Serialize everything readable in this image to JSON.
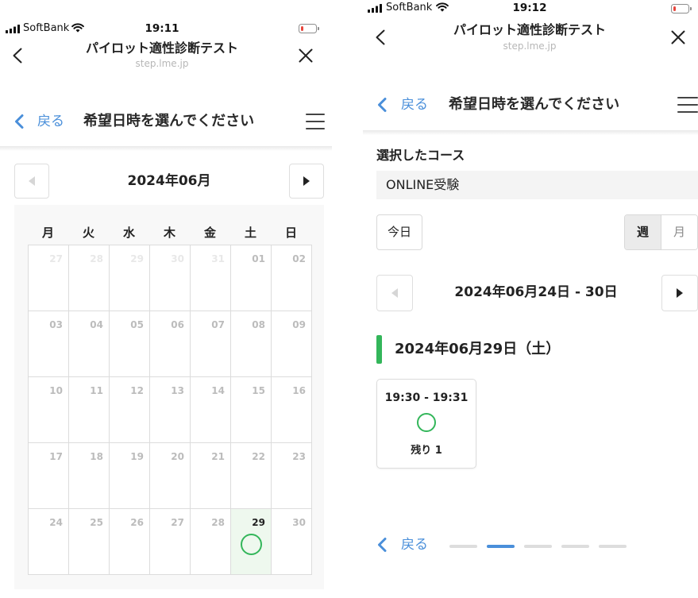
{
  "colors": {
    "accent": "#4a8fda",
    "green": "#33b65a",
    "available_bg": "#eef8ee",
    "battery_low": "#e8453c"
  },
  "left": {
    "status": {
      "carrier": "SoftBank",
      "time": "19:11",
      "battery_level": 0.15,
      "icons": [
        "signal-icon",
        "wifi-icon",
        "battery-icon"
      ]
    },
    "header": {
      "title": "パイロット適性診断テスト",
      "subtitle": "step.lme.jp",
      "back_icon": "chevron-left-icon",
      "close_icon": "close-icon"
    },
    "nav": {
      "back_label": "戻る",
      "title": "希望日時を選んでください",
      "menu_icon": "hamburger-menu-icon"
    },
    "calendar": {
      "month_label": "2024年06月",
      "prev_enabled": false,
      "next_enabled": true,
      "weekdays": [
        "月",
        "火",
        "水",
        "木",
        "金",
        "土",
        "日"
      ],
      "days": [
        {
          "label": "27",
          "muted": true
        },
        {
          "label": "28",
          "muted": true
        },
        {
          "label": "29",
          "muted": true
        },
        {
          "label": "30",
          "muted": true
        },
        {
          "label": "31",
          "muted": true
        },
        {
          "label": "01"
        },
        {
          "label": "02"
        },
        {
          "label": "03"
        },
        {
          "label": "04"
        },
        {
          "label": "05"
        },
        {
          "label": "06"
        },
        {
          "label": "07"
        },
        {
          "label": "08"
        },
        {
          "label": "09"
        },
        {
          "label": "10"
        },
        {
          "label": "11"
        },
        {
          "label": "12"
        },
        {
          "label": "13"
        },
        {
          "label": "14"
        },
        {
          "label": "15"
        },
        {
          "label": "16"
        },
        {
          "label": "17"
        },
        {
          "label": "18"
        },
        {
          "label": "19"
        },
        {
          "label": "20"
        },
        {
          "label": "21"
        },
        {
          "label": "22"
        },
        {
          "label": "23"
        },
        {
          "label": "24"
        },
        {
          "label": "25"
        },
        {
          "label": "26"
        },
        {
          "label": "27"
        },
        {
          "label": "28"
        },
        {
          "label": "29",
          "available": true
        },
        {
          "label": "30"
        }
      ]
    }
  },
  "right": {
    "status": {
      "carrier": "SoftBank",
      "time": "19:12",
      "battery_level": 0.15,
      "icons": [
        "signal-icon",
        "wifi-icon",
        "battery-icon"
      ]
    },
    "header": {
      "title": "パイロット適性診断テスト",
      "subtitle": "step.lme.jp",
      "back_icon": "chevron-left-icon",
      "close_icon": "close-icon"
    },
    "nav": {
      "back_label": "戻る",
      "title": "希望日時を選んでください",
      "menu_icon": "hamburger-menu-icon"
    },
    "course": {
      "label": "選択したコース",
      "value": "ONLINE受験"
    },
    "view_controls": {
      "today_label": "今日",
      "views": [
        {
          "label": "週",
          "active": true
        },
        {
          "label": "月",
          "active": false
        }
      ]
    },
    "week_nav": {
      "range_label": "2024年06月24日 - 30日",
      "prev_enabled": false,
      "next_enabled": true
    },
    "day": {
      "heading": "2024年06月29日（土）",
      "slots": [
        {
          "time": "19:30 - 19:31",
          "remaining": "残り 1",
          "status_icon": "available-circle-icon"
        }
      ]
    },
    "footer": {
      "back_label": "戻る",
      "progress": {
        "total": 5,
        "current": 2
      }
    }
  }
}
